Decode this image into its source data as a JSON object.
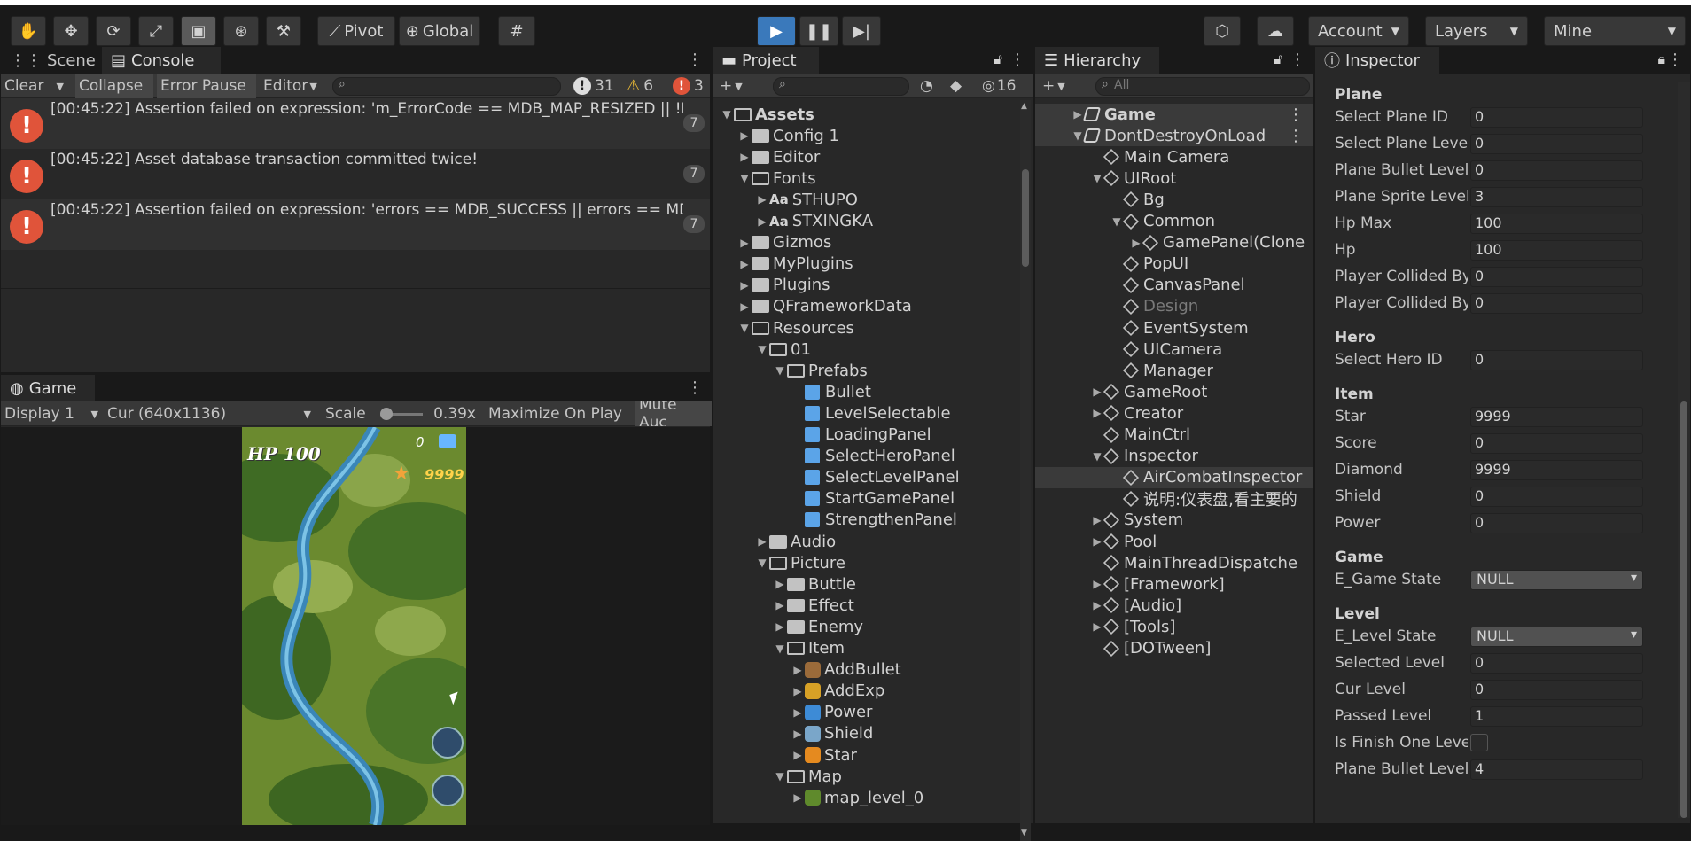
{
  "toolbar": {
    "pivot_label": "Pivot",
    "global_label": "Global",
    "account_label": "Account",
    "layers_label": "Layers",
    "layout_label": "Mine"
  },
  "console": {
    "tab_scene": "Scene",
    "tab_console": "Console",
    "clear_label": "Clear",
    "collapse_label": "Collapse",
    "error_pause_label": "Error Pause",
    "editor_label": "Editor",
    "log_count": "31",
    "warning_count": "6",
    "error_count": "3",
    "entries": [
      {
        "text": "[00:45:22] Assertion failed on expression: 'm_ErrorCode == MDB_MAP_RESIZED || !Ha",
        "count": "7"
      },
      {
        "text": "[00:45:22] Asset database transaction committed twice!",
        "count": "7"
      },
      {
        "text": "[00:45:22] Assertion failed on expression: 'errors == MDB_SUCCESS || errors == MDB",
        "count": "7"
      }
    ]
  },
  "game": {
    "tab_label": "Game",
    "display_label": "Display 1",
    "resolution_label": "Cur (640x1136)",
    "scale_label": "Scale",
    "scale_value": "0.39x",
    "maximize_label": "Maximize On Play",
    "mute_label": "Mute Auc",
    "hp_text": "HP 100",
    "score_text": "0",
    "star_text": "9999"
  },
  "project": {
    "tab_label": "Project",
    "hidden_count": "16",
    "items": [
      {
        "label": "Assets",
        "depth": 0,
        "arrow": "▼",
        "icon": "folder-open",
        "bold": true
      },
      {
        "label": "Config 1",
        "depth": 1,
        "arrow": "▶",
        "icon": "folder"
      },
      {
        "label": "Editor",
        "depth": 1,
        "arrow": "▶",
        "icon": "folder"
      },
      {
        "label": "Fonts",
        "depth": 1,
        "arrow": "▼",
        "icon": "folder-open"
      },
      {
        "label": "STHUPO",
        "depth": 2,
        "arrow": "▶",
        "icon": "font"
      },
      {
        "label": "STXINGKA",
        "depth": 2,
        "arrow": "▶",
        "icon": "font"
      },
      {
        "label": "Gizmos",
        "depth": 1,
        "arrow": "▶",
        "icon": "folder"
      },
      {
        "label": "MyPlugins",
        "depth": 1,
        "arrow": "▶",
        "icon": "folder"
      },
      {
        "label": "Plugins",
        "depth": 1,
        "arrow": "▶",
        "icon": "folder"
      },
      {
        "label": "QFrameworkData",
        "depth": 1,
        "arrow": "▶",
        "icon": "folder"
      },
      {
        "label": "Resources",
        "depth": 1,
        "arrow": "▼",
        "icon": "folder-open"
      },
      {
        "label": "01",
        "depth": 2,
        "arrow": "▼",
        "icon": "folder-open"
      },
      {
        "label": "Prefabs",
        "depth": 3,
        "arrow": "▼",
        "icon": "folder-open"
      },
      {
        "label": "Bullet",
        "depth": 4,
        "arrow": "",
        "icon": "prefab"
      },
      {
        "label": "LevelSelectable",
        "depth": 4,
        "arrow": "",
        "icon": "prefab"
      },
      {
        "label": "LoadingPanel",
        "depth": 4,
        "arrow": "",
        "icon": "prefab"
      },
      {
        "label": "SelectHeroPanel",
        "depth": 4,
        "arrow": "",
        "icon": "prefab"
      },
      {
        "label": "SelectLevelPanel",
        "depth": 4,
        "arrow": "",
        "icon": "prefab"
      },
      {
        "label": "StartGamePanel",
        "depth": 4,
        "arrow": "",
        "icon": "prefab"
      },
      {
        "label": "StrengthenPanel",
        "depth": 4,
        "arrow": "",
        "icon": "prefab"
      },
      {
        "label": "Audio",
        "depth": 2,
        "arrow": "▶",
        "icon": "folder"
      },
      {
        "label": "Picture",
        "depth": 2,
        "arrow": "▼",
        "icon": "folder-open"
      },
      {
        "label": "Buttle",
        "depth": 3,
        "arrow": "▶",
        "icon": "folder"
      },
      {
        "label": "Effect",
        "depth": 3,
        "arrow": "▶",
        "icon": "folder"
      },
      {
        "label": "Enemy",
        "depth": 3,
        "arrow": "▶",
        "icon": "folder"
      },
      {
        "label": "Item",
        "depth": 3,
        "arrow": "▼",
        "icon": "folder-open"
      },
      {
        "label": "AddBullet",
        "depth": 4,
        "arrow": "▶",
        "icon": "sprite-bullet"
      },
      {
        "label": "AddExp",
        "depth": 4,
        "arrow": "▶",
        "icon": "sprite-exp"
      },
      {
        "label": "Power",
        "depth": 4,
        "arrow": "▶",
        "icon": "sprite-power"
      },
      {
        "label": "Shield",
        "depth": 4,
        "arrow": "▶",
        "icon": "sprite-shield"
      },
      {
        "label": "Star",
        "depth": 4,
        "arrow": "▶",
        "icon": "sprite-star"
      },
      {
        "label": "Map",
        "depth": 3,
        "arrow": "▼",
        "icon": "folder-open"
      },
      {
        "label": "map_level_0",
        "depth": 4,
        "arrow": "▶",
        "icon": "sprite-map"
      }
    ]
  },
  "hierarchy": {
    "tab_label": "Hierarchy",
    "search_placeholder": "All",
    "items": [
      {
        "label": "Game",
        "depth": 0,
        "arrow": "▶",
        "icon": "scene",
        "bold": true,
        "kebab": true
      },
      {
        "label": "DontDestroyOnLoad",
        "depth": 0,
        "arrow": "▼",
        "icon": "scene",
        "kebab": true
      },
      {
        "label": "Main Camera",
        "depth": 1,
        "arrow": "",
        "icon": "cube"
      },
      {
        "label": "UIRoot",
        "depth": 1,
        "arrow": "▼",
        "icon": "cube"
      },
      {
        "label": "Bg",
        "depth": 2,
        "arrow": "",
        "icon": "cube"
      },
      {
        "label": "Common",
        "depth": 2,
        "arrow": "▼",
        "icon": "cube"
      },
      {
        "label": "GamePanel(Clone",
        "depth": 3,
        "arrow": "▶",
        "icon": "cube"
      },
      {
        "label": "PopUI",
        "depth": 2,
        "arrow": "",
        "icon": "cube"
      },
      {
        "label": "CanvasPanel",
        "depth": 2,
        "arrow": "",
        "icon": "cube"
      },
      {
        "label": "Design",
        "depth": 2,
        "arrow": "",
        "icon": "cube",
        "dim": true
      },
      {
        "label": "EventSystem",
        "depth": 2,
        "arrow": "",
        "icon": "cube"
      },
      {
        "label": "UICamera",
        "depth": 2,
        "arrow": "",
        "icon": "cube"
      },
      {
        "label": "Manager",
        "depth": 2,
        "arrow": "",
        "icon": "cube"
      },
      {
        "label": "GameRoot",
        "depth": 1,
        "arrow": "▶",
        "icon": "cube"
      },
      {
        "label": "Creator",
        "depth": 1,
        "arrow": "▶",
        "icon": "cube"
      },
      {
        "label": "MainCtrl",
        "depth": 1,
        "arrow": "",
        "icon": "cube"
      },
      {
        "label": "Inspector",
        "depth": 1,
        "arrow": "▼",
        "icon": "cube"
      },
      {
        "label": "AirCombatInspector",
        "depth": 2,
        "arrow": "",
        "icon": "cube",
        "selected": true
      },
      {
        "label": "说明:仪表盘,看主要的",
        "depth": 2,
        "arrow": "",
        "icon": "cube"
      },
      {
        "label": "System",
        "depth": 1,
        "arrow": "▶",
        "icon": "cube"
      },
      {
        "label": "Pool",
        "depth": 1,
        "arrow": "▶",
        "icon": "cube"
      },
      {
        "label": "MainThreadDispatche",
        "depth": 1,
        "arrow": "",
        "icon": "cube"
      },
      {
        "label": "[Framework]",
        "depth": 1,
        "arrow": "▶",
        "icon": "cube"
      },
      {
        "label": "[Audio]",
        "depth": 1,
        "arrow": "▶",
        "icon": "cube"
      },
      {
        "label": "[Tools]",
        "depth": 1,
        "arrow": "▶",
        "icon": "cube"
      },
      {
        "label": "[DOTween]",
        "depth": 1,
        "arrow": "",
        "icon": "cube"
      }
    ]
  },
  "inspector": {
    "tab_label": "Inspector",
    "rows": [
      {
        "kind": "header",
        "label": "Plane"
      },
      {
        "kind": "field",
        "label": "Select Plane ID",
        "value": "0"
      },
      {
        "kind": "field",
        "label": "Select Plane Level",
        "value": "0"
      },
      {
        "kind": "field",
        "label": "Plane Bullet Level",
        "value": "0"
      },
      {
        "kind": "field",
        "label": "Plane Sprite Level M",
        "value": "3"
      },
      {
        "kind": "field",
        "label": "Hp Max",
        "value": "100"
      },
      {
        "kind": "field",
        "label": "Hp",
        "value": "100"
      },
      {
        "kind": "field",
        "label": "Player Collided By P",
        "value": "0"
      },
      {
        "kind": "field",
        "label": "Player Collided By B",
        "value": "0"
      },
      {
        "kind": "header",
        "label": "Hero"
      },
      {
        "kind": "field",
        "label": "Select Hero ID",
        "value": "0"
      },
      {
        "kind": "header",
        "label": "Item"
      },
      {
        "kind": "field",
        "label": "Star",
        "value": "9999"
      },
      {
        "kind": "field",
        "label": "Score",
        "value": "0"
      },
      {
        "kind": "field",
        "label": "Diamond",
        "value": "9999"
      },
      {
        "kind": "field",
        "label": "Shield",
        "value": "0"
      },
      {
        "kind": "field",
        "label": "Power",
        "value": "0"
      },
      {
        "kind": "header",
        "label": "Game"
      },
      {
        "kind": "select",
        "label": "E_Game State",
        "value": "NULL"
      },
      {
        "kind": "header",
        "label": "Level"
      },
      {
        "kind": "select",
        "label": "E_Level State",
        "value": "NULL"
      },
      {
        "kind": "field",
        "label": "Selected Level",
        "value": "0"
      },
      {
        "kind": "field",
        "label": "Cur Level",
        "value": "0"
      },
      {
        "kind": "field",
        "label": "Passed Level",
        "value": "1"
      },
      {
        "kind": "check",
        "label": "Is Finish One Level",
        "value": "false"
      },
      {
        "kind": "field",
        "label": "Plane Bullet Level M",
        "value": "4"
      }
    ]
  }
}
